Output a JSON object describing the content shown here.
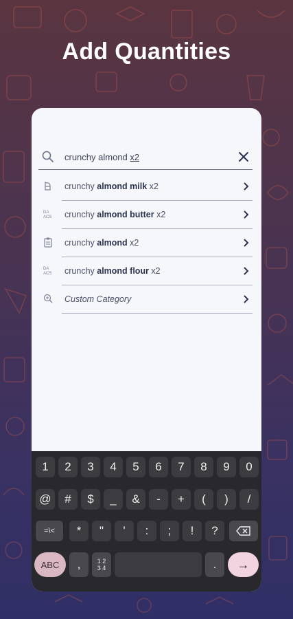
{
  "headline": "Add Quantities",
  "search": {
    "query_prefix": "crunchy almond ",
    "query_suffix": "x2"
  },
  "suggestions": [
    {
      "icon": "milk-carton-icon",
      "pre": "crunchy ",
      "bold": "almond milk",
      "post": " x2",
      "italic": false
    },
    {
      "icon": "jar-label-icon",
      "pre": "crunchy ",
      "bold": "almond butter",
      "post": " x2",
      "italic": false
    },
    {
      "icon": "clipboard-icon",
      "pre": "crunchy ",
      "bold": "almond",
      "post": " x2",
      "italic": false
    },
    {
      "icon": "jar-label-icon",
      "pre": "crunchy ",
      "bold": "almond flour",
      "post": " x2",
      "italic": false
    },
    {
      "icon": "zoom-plus-icon",
      "pre": "Custom Category",
      "bold": "",
      "post": "",
      "italic": true
    }
  ],
  "keyboard": {
    "row1": [
      "1",
      "2",
      "3",
      "4",
      "5",
      "6",
      "7",
      "8",
      "9",
      "0"
    ],
    "row2": [
      "@",
      "#",
      "$",
      "_",
      "&",
      "-",
      "+",
      "(",
      ")",
      "/"
    ],
    "row3": [
      "=\\<",
      "*",
      "\"",
      "'",
      ":",
      ";",
      "!",
      "?"
    ],
    "backspace_icon": "backspace-icon",
    "abc_label": "ABC",
    "comma": ",",
    "frac_top": "1 2",
    "frac_bottom": "3 4",
    "period": ".",
    "enter_glyph": "→"
  }
}
